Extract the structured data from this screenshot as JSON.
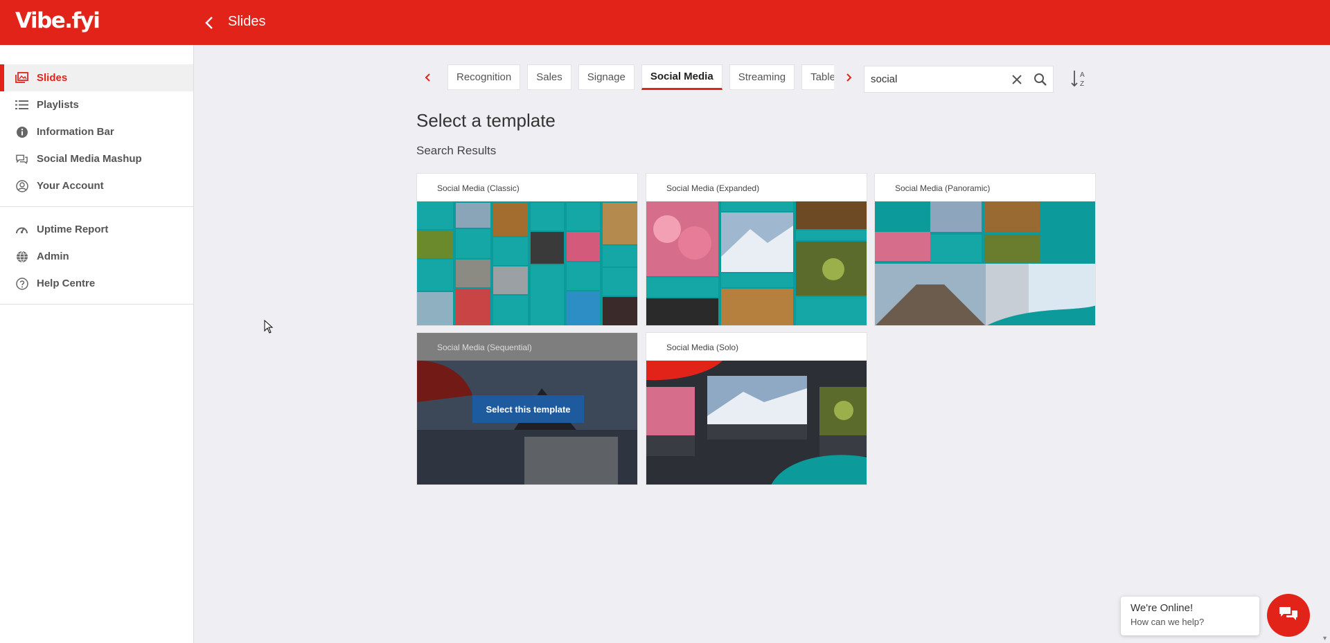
{
  "app": {
    "logo": "Vibe.fyi",
    "page_title": "Slides"
  },
  "sidebar": {
    "group1": [
      {
        "label": "Slides",
        "icon": "slides-icon",
        "active": true
      },
      {
        "label": "Playlists",
        "icon": "list-icon"
      },
      {
        "label": "Information Bar",
        "icon": "info-icon"
      },
      {
        "label": "Social Media Mashup",
        "icon": "chat-icon"
      },
      {
        "label": "Your Account",
        "icon": "user-icon"
      }
    ],
    "group2": [
      {
        "label": "Uptime Report",
        "icon": "dashboard-icon"
      },
      {
        "label": "Admin",
        "icon": "globe-icon"
      },
      {
        "label": "Help Centre",
        "icon": "help-icon"
      }
    ]
  },
  "tabs": {
    "items": [
      "Recognition",
      "Sales",
      "Signage",
      "Social Media",
      "Streaming",
      "Tables"
    ],
    "active": "Social Media"
  },
  "search": {
    "value": "social"
  },
  "main": {
    "heading": "Select a template",
    "subheading": "Search Results"
  },
  "cards": [
    {
      "title": "Social Media (Classic)"
    },
    {
      "title": "Social Media (Expanded)"
    },
    {
      "title": "Social Media (Panoramic)"
    },
    {
      "title": "Social Media (Sequential)",
      "button": "Select this template"
    },
    {
      "title": "Social Media (Solo)"
    }
  ],
  "chat": {
    "title": "We're Online!",
    "subtitle": "How can we help?"
  },
  "colors": {
    "brand_red": "#e2231a",
    "teal": "#0d9a9a",
    "button_blue": "#1d5a9e"
  }
}
